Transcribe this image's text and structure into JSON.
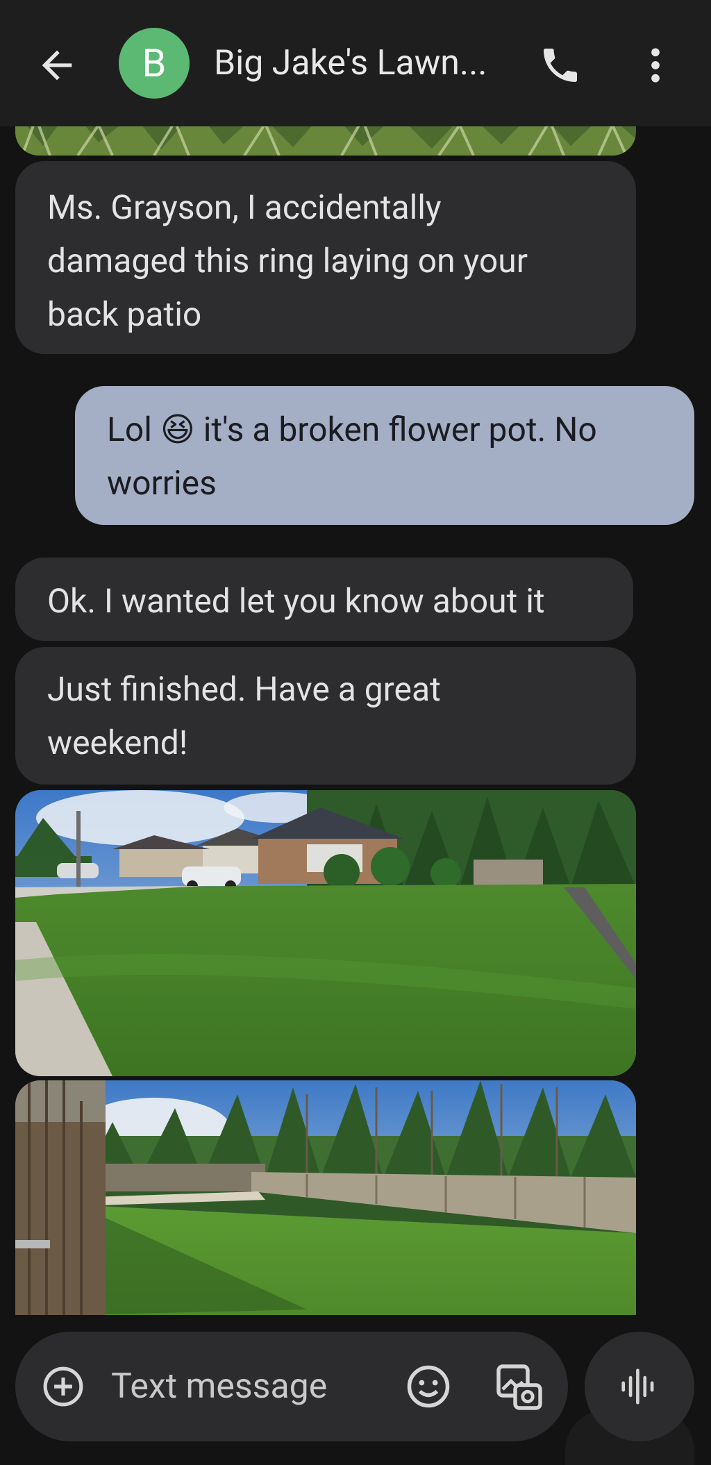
{
  "header": {
    "avatar_letter": "B",
    "avatar_color": "#5bb974",
    "contact_name": "Big Jake's Lawn..."
  },
  "messages": [
    {
      "direction": "incoming",
      "type": "image",
      "description": "Top edge of a grass photo"
    },
    {
      "direction": "incoming",
      "type": "text",
      "lines": [
        "Ms. Grayson, I accidentally",
        "damaged this ring laying on  your",
        "back patio"
      ]
    },
    {
      "direction": "outgoing",
      "type": "text",
      "line1_before": "Lol ",
      "emoji": "😆",
      "line1_after": " it's a broken flower pot. No",
      "line2": "worries"
    },
    {
      "direction": "incoming",
      "type": "text",
      "lines": [
        "Ok.  I wanted let you know about it"
      ]
    },
    {
      "direction": "incoming",
      "type": "text",
      "lines": [
        "Just finished. Have a great",
        "weekend!"
      ]
    },
    {
      "direction": "incoming",
      "type": "image",
      "description": "Freshly mowed front lawn with a brick house and white SUV"
    },
    {
      "direction": "incoming",
      "type": "image",
      "description": "Freshly mowed back yard with wooden fence and tall pine trees"
    }
  ],
  "composer": {
    "placeholder": "Text message"
  },
  "colors": {
    "background": "#131313",
    "topbar": "#1e1e1e",
    "incoming_bubble": "#2d2d2f",
    "outgoing_bubble": "#a4aec4"
  },
  "icons": [
    "back-arrow-icon",
    "phone-icon",
    "more-vert-icon",
    "add-circle-icon",
    "emoji-icon",
    "gallery-icon",
    "voice-waveform-icon"
  ]
}
